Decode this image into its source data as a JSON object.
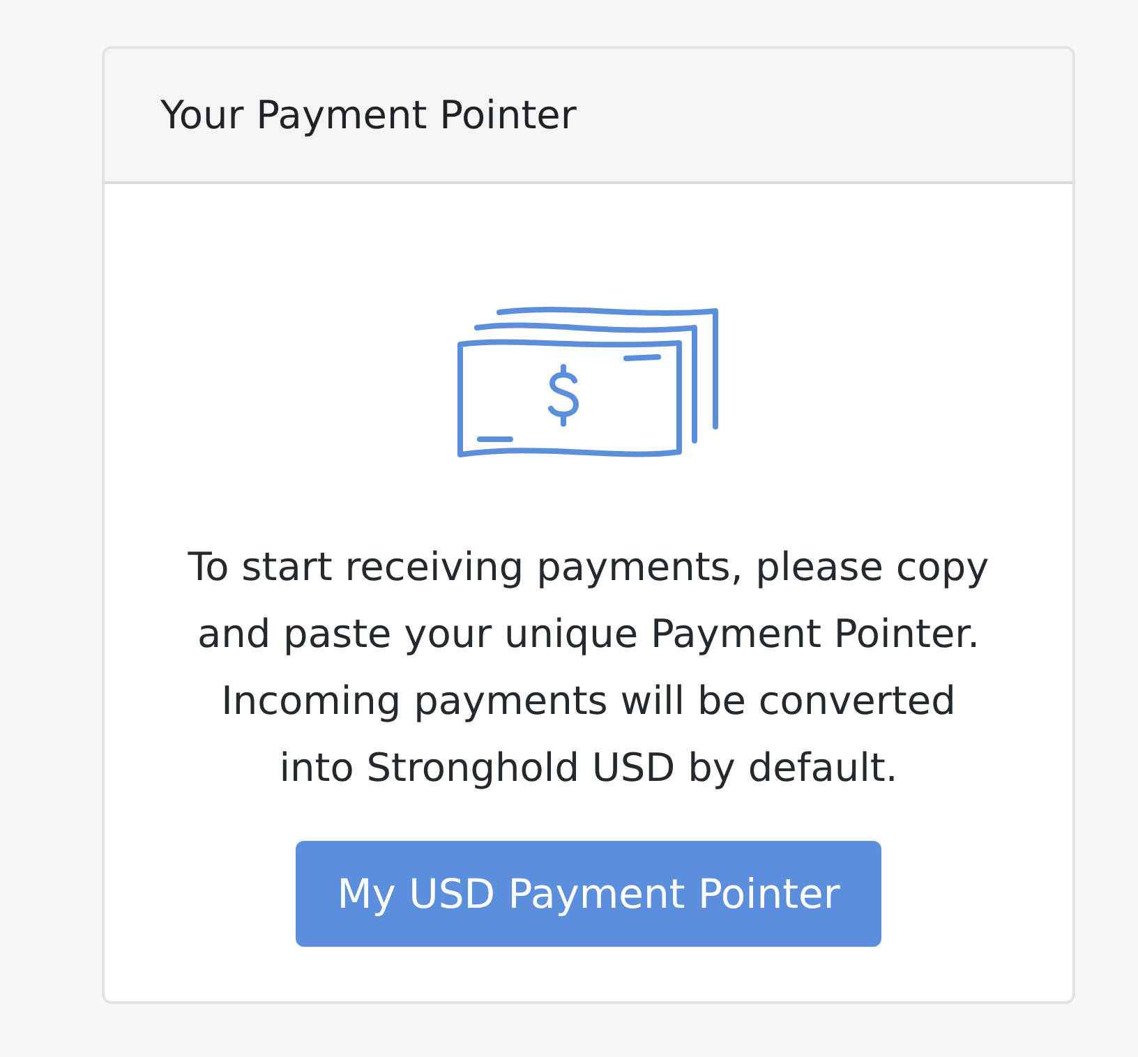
{
  "card": {
    "title": "Your Payment Pointer",
    "message": "To start receiving payments, please copy and paste your unique Payment Pointer. Incoming payments will be converted into Stronghold USD by default.",
    "button": "My USD Payment Pointer"
  }
}
